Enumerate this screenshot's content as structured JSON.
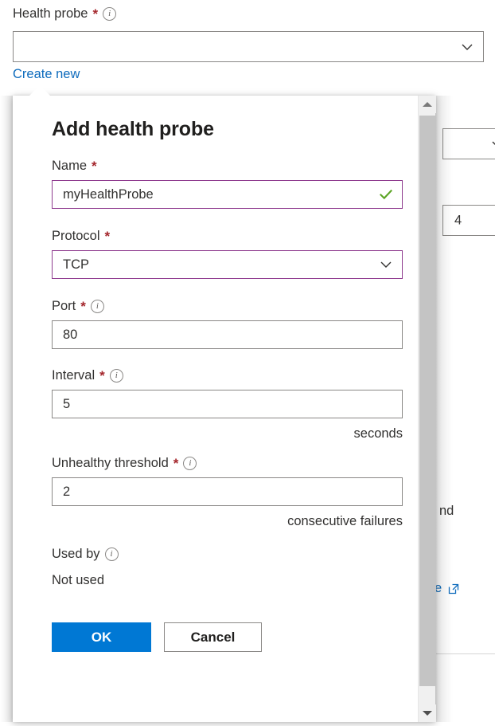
{
  "background": {
    "health_probe_label": "Health probe",
    "required_marker": "*",
    "info_icon": "info-icon",
    "health_probe_value": "",
    "create_new_link": "Create new",
    "peek_combo_value": "",
    "peek_field_value": "4",
    "peek_text_fragment": "nd",
    "peek_link_text": "e",
    "peek_link_icon": "external-link-icon"
  },
  "flyout": {
    "title": "Add health probe",
    "fields": {
      "name": {
        "label": "Name",
        "required_marker": "*",
        "value": "myHealthProbe",
        "valid_icon": "checkmark-icon",
        "valid_color": "#5ba424",
        "border_color": "#8e3a8e"
      },
      "protocol": {
        "label": "Protocol",
        "required_marker": "*",
        "value": "TCP",
        "chevron_icon": "chevron-down-icon",
        "border_color": "#8e3a8e"
      },
      "port": {
        "label": "Port",
        "required_marker": "*",
        "info_icon": "info-icon",
        "value": "80"
      },
      "interval": {
        "label": "Interval",
        "required_marker": "*",
        "info_icon": "info-icon",
        "value": "5",
        "suffix": "seconds"
      },
      "unhealthy_threshold": {
        "label": "Unhealthy threshold",
        "required_marker": "*",
        "info_icon": "info-icon",
        "value": "2",
        "suffix": "consecutive failures"
      },
      "used_by": {
        "label": "Used by",
        "info_icon": "info-icon",
        "value": "Not used"
      }
    },
    "buttons": {
      "ok_label": "OK",
      "cancel_label": "Cancel",
      "primary_color": "#0078d4"
    },
    "scrollbar": {
      "up_arrow": "scroll-up-arrow-icon",
      "down_arrow": "scroll-down-arrow-icon"
    }
  }
}
